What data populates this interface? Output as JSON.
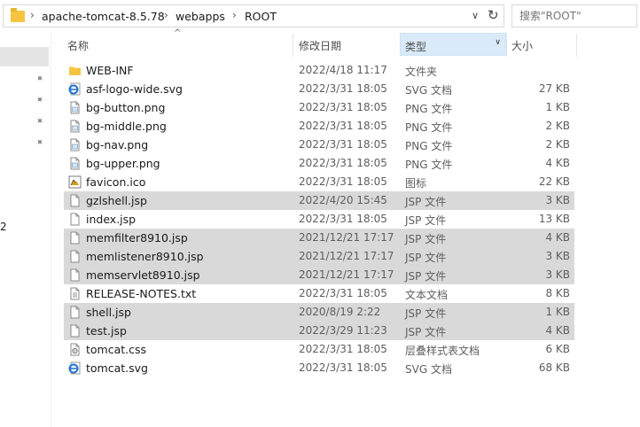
{
  "address_bar": {
    "path": [
      "apache-tomcat-8.5.78",
      "webapps",
      "ROOT"
    ],
    "search_placeholder": "搜索\"ROOT\""
  },
  "nav": {
    "visible_number": "2"
  },
  "columns": {
    "name": "名称",
    "date": "修改日期",
    "type": "类型",
    "size": "大小"
  },
  "files": [
    {
      "name": "WEB-INF",
      "date": "2022/4/18 11:17",
      "type": "文件夹",
      "size": "",
      "icon": "folder-icon",
      "selected": false
    },
    {
      "name": "asf-logo-wide.svg",
      "date": "2022/3/31 18:05",
      "type": "SVG 文档",
      "size": "27 KB",
      "icon": "svg-file-icon",
      "selected": false
    },
    {
      "name": "bg-button.png",
      "date": "2022/3/31 18:05",
      "type": "PNG 文件",
      "size": "1 KB",
      "icon": "image-file-icon",
      "selected": false
    },
    {
      "name": "bg-middle.png",
      "date": "2022/3/31 18:05",
      "type": "PNG 文件",
      "size": "2 KB",
      "icon": "image-file-icon",
      "selected": false
    },
    {
      "name": "bg-nav.png",
      "date": "2022/3/31 18:05",
      "type": "PNG 文件",
      "size": "2 KB",
      "icon": "image-file-icon",
      "selected": false
    },
    {
      "name": "bg-upper.png",
      "date": "2022/3/31 18:05",
      "type": "PNG 文件",
      "size": "4 KB",
      "icon": "image-file-icon",
      "selected": false
    },
    {
      "name": "favicon.ico",
      "date": "2022/3/31 18:05",
      "type": "图标",
      "size": "22 KB",
      "icon": "tomcat-icon",
      "selected": false
    },
    {
      "name": "gzlshell.jsp",
      "date": "2022/4/20 15:45",
      "type": "JSP 文件",
      "size": "3 KB",
      "icon": "generic-file-icon",
      "selected": true
    },
    {
      "name": "index.jsp",
      "date": "2022/3/31 18:05",
      "type": "JSP 文件",
      "size": "13 KB",
      "icon": "generic-file-icon",
      "selected": false
    },
    {
      "name": "memfilter8910.jsp",
      "date": "2021/12/21 17:17",
      "type": "JSP 文件",
      "size": "4 KB",
      "icon": "generic-file-icon",
      "selected": true
    },
    {
      "name": "memlistener8910.jsp",
      "date": "2021/12/21 17:17",
      "type": "JSP 文件",
      "size": "3 KB",
      "icon": "generic-file-icon",
      "selected": true
    },
    {
      "name": "memservlet8910.jsp",
      "date": "2021/12/21 17:17",
      "type": "JSP 文件",
      "size": "3 KB",
      "icon": "generic-file-icon",
      "selected": true
    },
    {
      "name": "RELEASE-NOTES.txt",
      "date": "2022/3/31 18:05",
      "type": "文本文档",
      "size": "8 KB",
      "icon": "text-file-icon",
      "selected": false
    },
    {
      "name": "shell.jsp",
      "date": "2020/8/19 2:22",
      "type": "JSP 文件",
      "size": "1 KB",
      "icon": "generic-file-icon",
      "selected": true
    },
    {
      "name": "test.jsp",
      "date": "2022/3/29 11:23",
      "type": "JSP 文件",
      "size": "4 KB",
      "icon": "generic-file-icon",
      "selected": true
    },
    {
      "name": "tomcat.css",
      "date": "2022/3/31 18:05",
      "type": "层叠样式表文档",
      "size": "6 KB",
      "icon": "css-file-icon",
      "selected": false
    },
    {
      "name": "tomcat.svg",
      "date": "2022/3/31 18:05",
      "type": "SVG 文档",
      "size": "68 KB",
      "icon": "svg-file-icon",
      "selected": false
    }
  ]
}
